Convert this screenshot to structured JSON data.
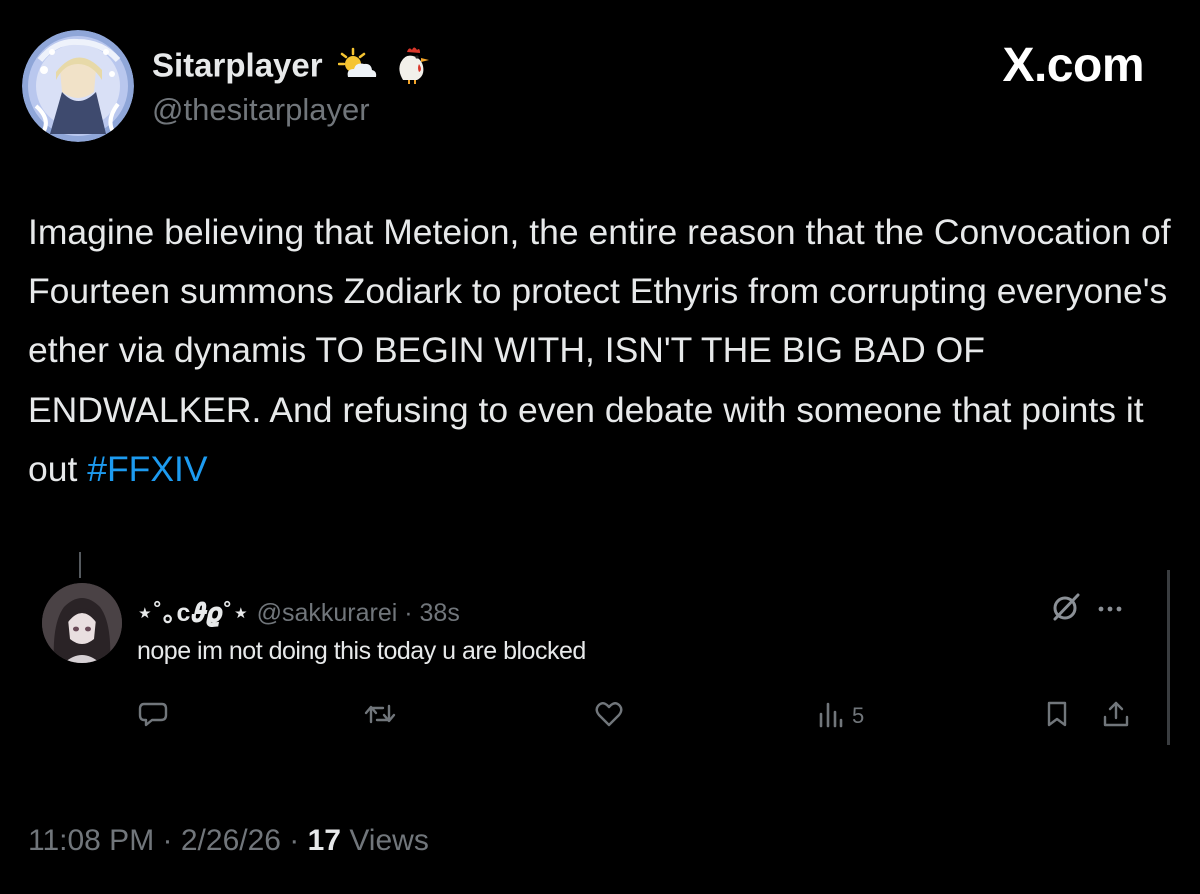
{
  "author": {
    "display_name": "Sitarplayer",
    "handle": "@thesitarplayer",
    "name_emojis": [
      "sun-behind-cloud-icon",
      "rooster-icon"
    ]
  },
  "brand": {
    "label": "X.com"
  },
  "tweet": {
    "text": "Imagine believing that Meteion, the entire reason that the Convocation of Fourteen summons Zodiark to protect Ethyris from corrupting everyone's ether via dynamis TO BEGIN WITH, ISN'T THE BIG BAD OF ENDWALKER. And refusing to even debate with someone that points it out ",
    "hashtag": "#FFXIV"
  },
  "reply": {
    "display_name": "⋆˚｡c𝝑𝝔˚⋆",
    "handle": "@sakkurarei",
    "separator": " · ",
    "time": "38s",
    "text": "nope im not doing this today u are blocked",
    "views_count": "5"
  },
  "footer": {
    "time": "11:08 PM",
    "separator_1": " · ",
    "date": "2/26/26",
    "separator_2": " · ",
    "views_count": "17",
    "views_label": " Views"
  },
  "colors": {
    "background": "#000000",
    "text_primary": "#e7e9ea",
    "text_secondary": "#71767b",
    "link": "#1d9bf0"
  }
}
